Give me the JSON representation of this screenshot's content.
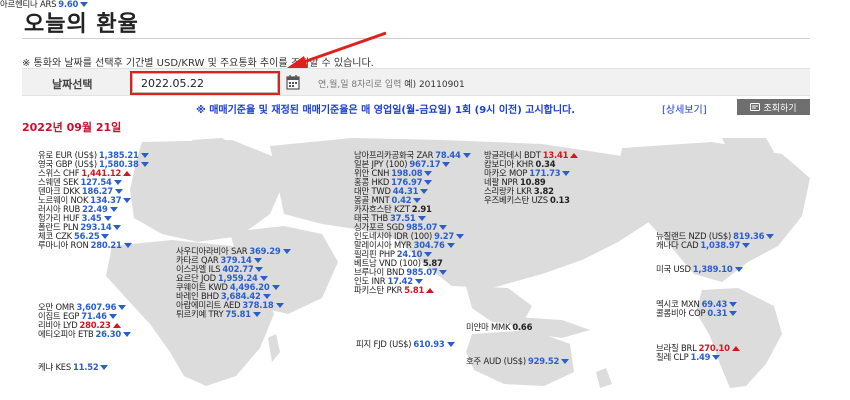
{
  "page": {
    "title": "오늘의 환율",
    "notice": "※ 통화와 날짜를 선택후 기간별 USD/KRW 및 주요통화 추이를 조회할 수 있습니다."
  },
  "date_search": {
    "label": "날짜선택",
    "value": "2022.05.22",
    "help_text": "연,월,일 8자리로 입력",
    "help_example": "예) 20110901",
    "rate_notice": "※ 매매기준율 및 재정된 매매기준율은 매 영업일(월-금요일) 1회 (9시 이전) 고시합니다.",
    "detail_link": "[상세보기]",
    "search_button": "조회하기"
  },
  "result_date": "2022년 09월 21일",
  "rates": [
    {
      "label": "유로 EUR (US$)",
      "value": "1,385.21",
      "trend": "down"
    },
    {
      "label": "영국 GBP (US$)",
      "value": "1,580.38",
      "trend": "down"
    },
    {
      "label": "스위스 CHF",
      "value": "1,441.12",
      "trend": "up"
    },
    {
      "label": "스웨덴 SEK",
      "value": "127.54",
      "trend": "down"
    },
    {
      "label": "덴마크 DKK",
      "value": "186.27",
      "trend": "down"
    },
    {
      "label": "노르웨이 NOK",
      "value": "134.37",
      "trend": "down"
    },
    {
      "label": "러시아 RUB",
      "value": "22.49",
      "trend": "down"
    },
    {
      "label": "헝가리 HUF",
      "value": "3.45",
      "trend": "down"
    },
    {
      "label": "폴란드 PLN",
      "value": "293.14",
      "trend": "down"
    },
    {
      "label": "체코 CZK",
      "value": "56.25",
      "trend": "down"
    },
    {
      "label": "루마니아 RON",
      "value": "280.21",
      "trend": "down"
    },
    {
      "label": "사우디아라비아 SAR",
      "value": "369.29",
      "trend": "down"
    },
    {
      "label": "카타르 QAR",
      "value": "379.14",
      "trend": "down"
    },
    {
      "label": "이스라엘 ILS",
      "value": "402.77",
      "trend": "down"
    },
    {
      "label": "요르단 JOD",
      "value": "1,959.24",
      "trend": "down"
    },
    {
      "label": "쿠웨이트 KWD",
      "value": "4,496.20",
      "trend": "down"
    },
    {
      "label": "바레인 BHD",
      "value": "3,684.42",
      "trend": "down"
    },
    {
      "label": "아랍에미리트 AED",
      "value": "378.18",
      "trend": "down"
    },
    {
      "label": "튀르키예 TRY",
      "value": "75.81",
      "trend": "down"
    },
    {
      "label": "오만 OMR",
      "value": "3,607.96",
      "trend": "down"
    },
    {
      "label": "이집트 EGP",
      "value": "71.46",
      "trend": "down"
    },
    {
      "label": "리비아 LYD",
      "value": "280.23",
      "trend": "up"
    },
    {
      "label": "에티오피아 ETB",
      "value": "26.30",
      "trend": "down"
    },
    {
      "label": "케냐 KES",
      "value": "11.52",
      "trend": "down"
    },
    {
      "label": "남아프리카공화국 ZAR",
      "value": "78.44",
      "trend": "down"
    },
    {
      "label": "일본 JPY (100)",
      "value": "967.17",
      "trend": "down"
    },
    {
      "label": "위안 CNH",
      "value": "198.08",
      "trend": "down"
    },
    {
      "label": "홍콩 HKD",
      "value": "176.97",
      "trend": "down"
    },
    {
      "label": "대만 TWD",
      "value": "44.31",
      "trend": "down"
    },
    {
      "label": "몽골 MNT",
      "value": "0.42",
      "trend": "down"
    },
    {
      "label": "카자흐스탄 KZT",
      "value": "2.91",
      "trend": "flat"
    },
    {
      "label": "태국 THB",
      "value": "37.51",
      "trend": "down"
    },
    {
      "label": "싱가포르 SGD",
      "value": "985.07",
      "trend": "down"
    },
    {
      "label": "인도네시아 IDR (100)",
      "value": "9.27",
      "trend": "down"
    },
    {
      "label": "말레이시아 MYR",
      "value": "304.76",
      "trend": "down"
    },
    {
      "label": "필리핀 PHP",
      "value": "24.10",
      "trend": "down"
    },
    {
      "label": "베트남 VND (100)",
      "value": "5.87",
      "trend": "flat"
    },
    {
      "label": "브루나이 BND",
      "value": "985.07",
      "trend": "down"
    },
    {
      "label": "인도 INR",
      "value": "17.42",
      "trend": "down"
    },
    {
      "label": "파키스탄 PKR",
      "value": "5.81",
      "trend": "up"
    },
    {
      "label": "방글라데시 BDT",
      "value": "13.41",
      "trend": "up"
    },
    {
      "label": "캄보디아 KHR",
      "value": "0.34",
      "trend": "flat"
    },
    {
      "label": "마카오 MOP",
      "value": "171.73",
      "trend": "down"
    },
    {
      "label": "네팔 NPR",
      "value": "10.89",
      "trend": "flat"
    },
    {
      "label": "스리랑카 LKR",
      "value": "3.82",
      "trend": "flat"
    },
    {
      "label": "우즈베키스탄 UZS",
      "value": "0.13",
      "trend": "flat"
    },
    {
      "label": "미얀마 MMK",
      "value": "0.66",
      "trend": "flat"
    },
    {
      "label": "피지 FJD (US$)",
      "value": "610.93",
      "trend": "down"
    },
    {
      "label": "호주 AUD (US$)",
      "value": "929.52",
      "trend": "down"
    },
    {
      "label": "뉴질랜드 NZD (US$)",
      "value": "819.36",
      "trend": "down"
    },
    {
      "label": "캐나다 CAD",
      "value": "1,038.97",
      "trend": "down"
    },
    {
      "label": "미국 USD",
      "value": "1,389.10",
      "trend": "down"
    },
    {
      "label": "멕시코 MXN",
      "value": "69.43",
      "trend": "down"
    },
    {
      "label": "콜롬비아 COP",
      "value": "0.31",
      "trend": "down"
    },
    {
      "label": "브라질 BRL",
      "value": "270.10",
      "trend": "up"
    },
    {
      "label": "칠레 CLP",
      "value": "1.49",
      "trend": "down"
    },
    {
      "label": "아르헨티나 ARS",
      "value": "9.60",
      "trend": "down"
    }
  ]
}
